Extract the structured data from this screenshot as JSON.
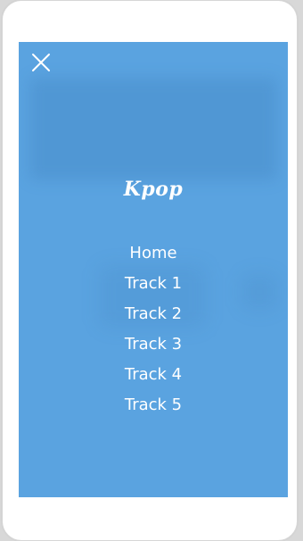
{
  "app": {
    "title": "Kpop"
  },
  "menu": {
    "items": [
      "Home",
      "Track 1",
      "Track 2",
      "Track 3",
      "Track 4",
      "Track 5"
    ]
  },
  "icons": {
    "close": "close-icon"
  },
  "colors": {
    "panel_background": "#5aa3e0",
    "text": "#ffffff",
    "device_frame": "#ffffff"
  }
}
